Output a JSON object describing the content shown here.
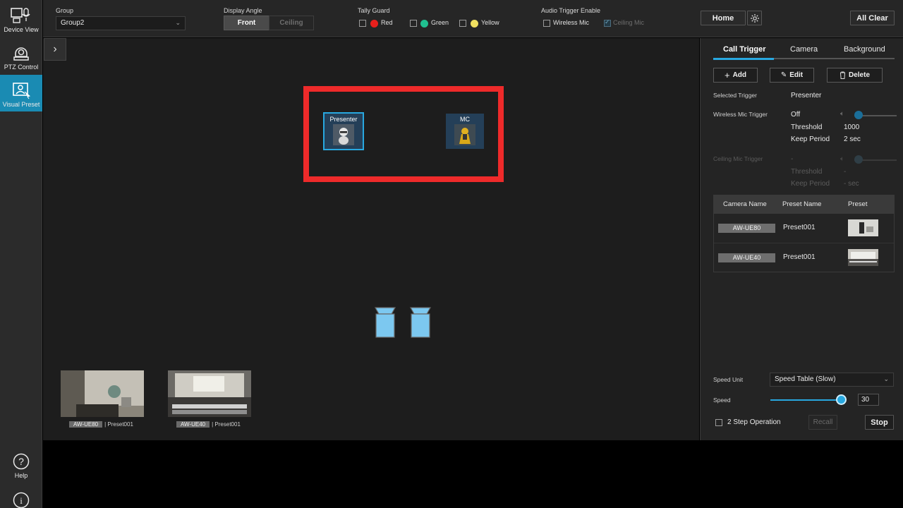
{
  "nav": {
    "items": [
      {
        "label": "Device View",
        "icon": "device-view-icon"
      },
      {
        "label": "PTZ Control",
        "icon": "ptz-camera-icon"
      },
      {
        "label": "Visual Preset",
        "icon": "visual-preset-icon"
      }
    ],
    "help_label": "Help",
    "active": "Visual Preset"
  },
  "topbar": {
    "group_label": "Group",
    "group_value": "Group2",
    "display_angle_label": "Display Angle",
    "angle_front": "Front",
    "angle_ceiling": "Ceiling",
    "tally_label": "Tally Guard",
    "tally": [
      {
        "label": "Red",
        "color": "#e8201c"
      },
      {
        "label": "Green",
        "color": "#20c090"
      },
      {
        "label": "Yellow",
        "color": "#f0e060"
      }
    ],
    "audio_label": "Audio Trigger Enable",
    "wireless_mic": "Wireless Mic",
    "ceiling_mic": "Ceiling Mic",
    "home": "Home",
    "all_clear": "All Clear"
  },
  "canvas": {
    "triggers": [
      {
        "name": "Presenter",
        "selected": true
      },
      {
        "name": "MC",
        "selected": false
      }
    ],
    "presets": [
      {
        "camera": "AW-UE80",
        "preset": "| Preset001"
      },
      {
        "camera": "AW-UE40",
        "preset": "| Preset001"
      }
    ]
  },
  "panel": {
    "tabs": [
      "Call Trigger",
      "Camera",
      "Background"
    ],
    "add": "Add",
    "edit": "Edit",
    "delete": "Delete",
    "selected_trigger_label": "Selected Trigger",
    "selected_trigger_value": "Presenter",
    "wireless_label": "Wireless Mic Trigger",
    "wireless_state": "Off",
    "threshold_label": "Threshold",
    "threshold_value": "1000",
    "keep_label": "Keep Period",
    "keep_value": "2 sec",
    "ceiling_label": "Ceiling Mic Trigger",
    "ceiling_state": "-",
    "ceiling_threshold_value": "-",
    "ceiling_keep_value": "- sec",
    "table_headers": [
      "Camera Name",
      "Preset Name",
      "Preset"
    ],
    "table_rows": [
      {
        "camera": "AW-UE80",
        "preset": "Preset001"
      },
      {
        "camera": "AW-UE40",
        "preset": "Preset001"
      }
    ],
    "speed_unit_label": "Speed Unit",
    "speed_unit_value": "Speed Table (Slow)",
    "speed_label": "Speed",
    "speed_value": "30",
    "speed_fraction": 0.95,
    "two_step": "2 Step Operation",
    "recall": "Recall",
    "stop": "Stop"
  },
  "colors": {
    "accent": "#28a8e0",
    "highlight": "#ee2a2a",
    "nav_active": "#1a8bb3"
  }
}
